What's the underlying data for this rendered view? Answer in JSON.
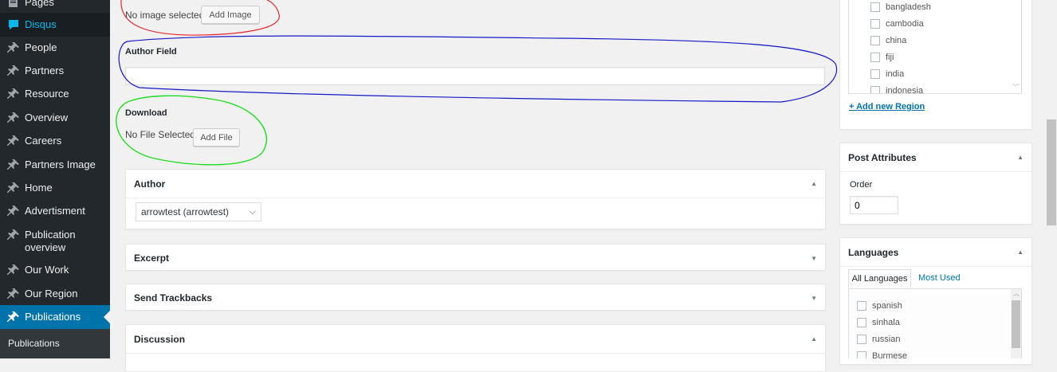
{
  "sidebar": {
    "items": [
      {
        "label": "Pages",
        "icon": "pages-icon"
      },
      {
        "label": "Disqus",
        "icon": "disqus-icon"
      },
      {
        "label": "People",
        "icon": "pin-icon"
      },
      {
        "label": "Partners",
        "icon": "pin-icon"
      },
      {
        "label": "Resource",
        "icon": "pin-icon"
      },
      {
        "label": "Overview",
        "icon": "pin-icon"
      },
      {
        "label": "Careers",
        "icon": "pin-icon"
      },
      {
        "label": "Partners Image",
        "icon": "pin-icon"
      },
      {
        "label": "Home",
        "icon": "pin-icon"
      },
      {
        "label": "Advertisment",
        "icon": "pin-icon"
      },
      {
        "label": "Publication overview",
        "icon": "pin-icon"
      },
      {
        "label": "Our Work",
        "icon": "pin-icon"
      },
      {
        "label": "Our Region",
        "icon": "pin-icon"
      },
      {
        "label": "Publications",
        "icon": "pin-icon"
      }
    ],
    "submenu_label": "Publications",
    "accent": "#0073aa"
  },
  "image_field": {
    "status": "No image selected",
    "button": "Add Image"
  },
  "author_field": {
    "label": "Author Field",
    "value": ""
  },
  "download_field": {
    "label": "Download",
    "status": "No File Selected.",
    "button": "Add File"
  },
  "author_box": {
    "title": "Author",
    "selected": "arrowtest (arrowtest)"
  },
  "excerpt_box": {
    "title": "Excerpt"
  },
  "trackbacks_box": {
    "title": "Send Trackbacks"
  },
  "discussion_box": {
    "title": "Discussion"
  },
  "regions": {
    "items": [
      "bangladesh",
      "cambodia",
      "china",
      "fiji",
      "india",
      "indonesia"
    ],
    "add_link": "+ Add new Region"
  },
  "post_attributes": {
    "title": "Post Attributes",
    "order_label": "Order",
    "order_value": "0"
  },
  "languages": {
    "title": "Languages",
    "tabs": [
      "All Languages",
      "Most Used"
    ],
    "items": [
      "spanish",
      "sinhala",
      "russian",
      "Burmese"
    ]
  },
  "annotations": {
    "red": "#e8262a",
    "blue": "#1919c8",
    "green": "#22dd22"
  }
}
